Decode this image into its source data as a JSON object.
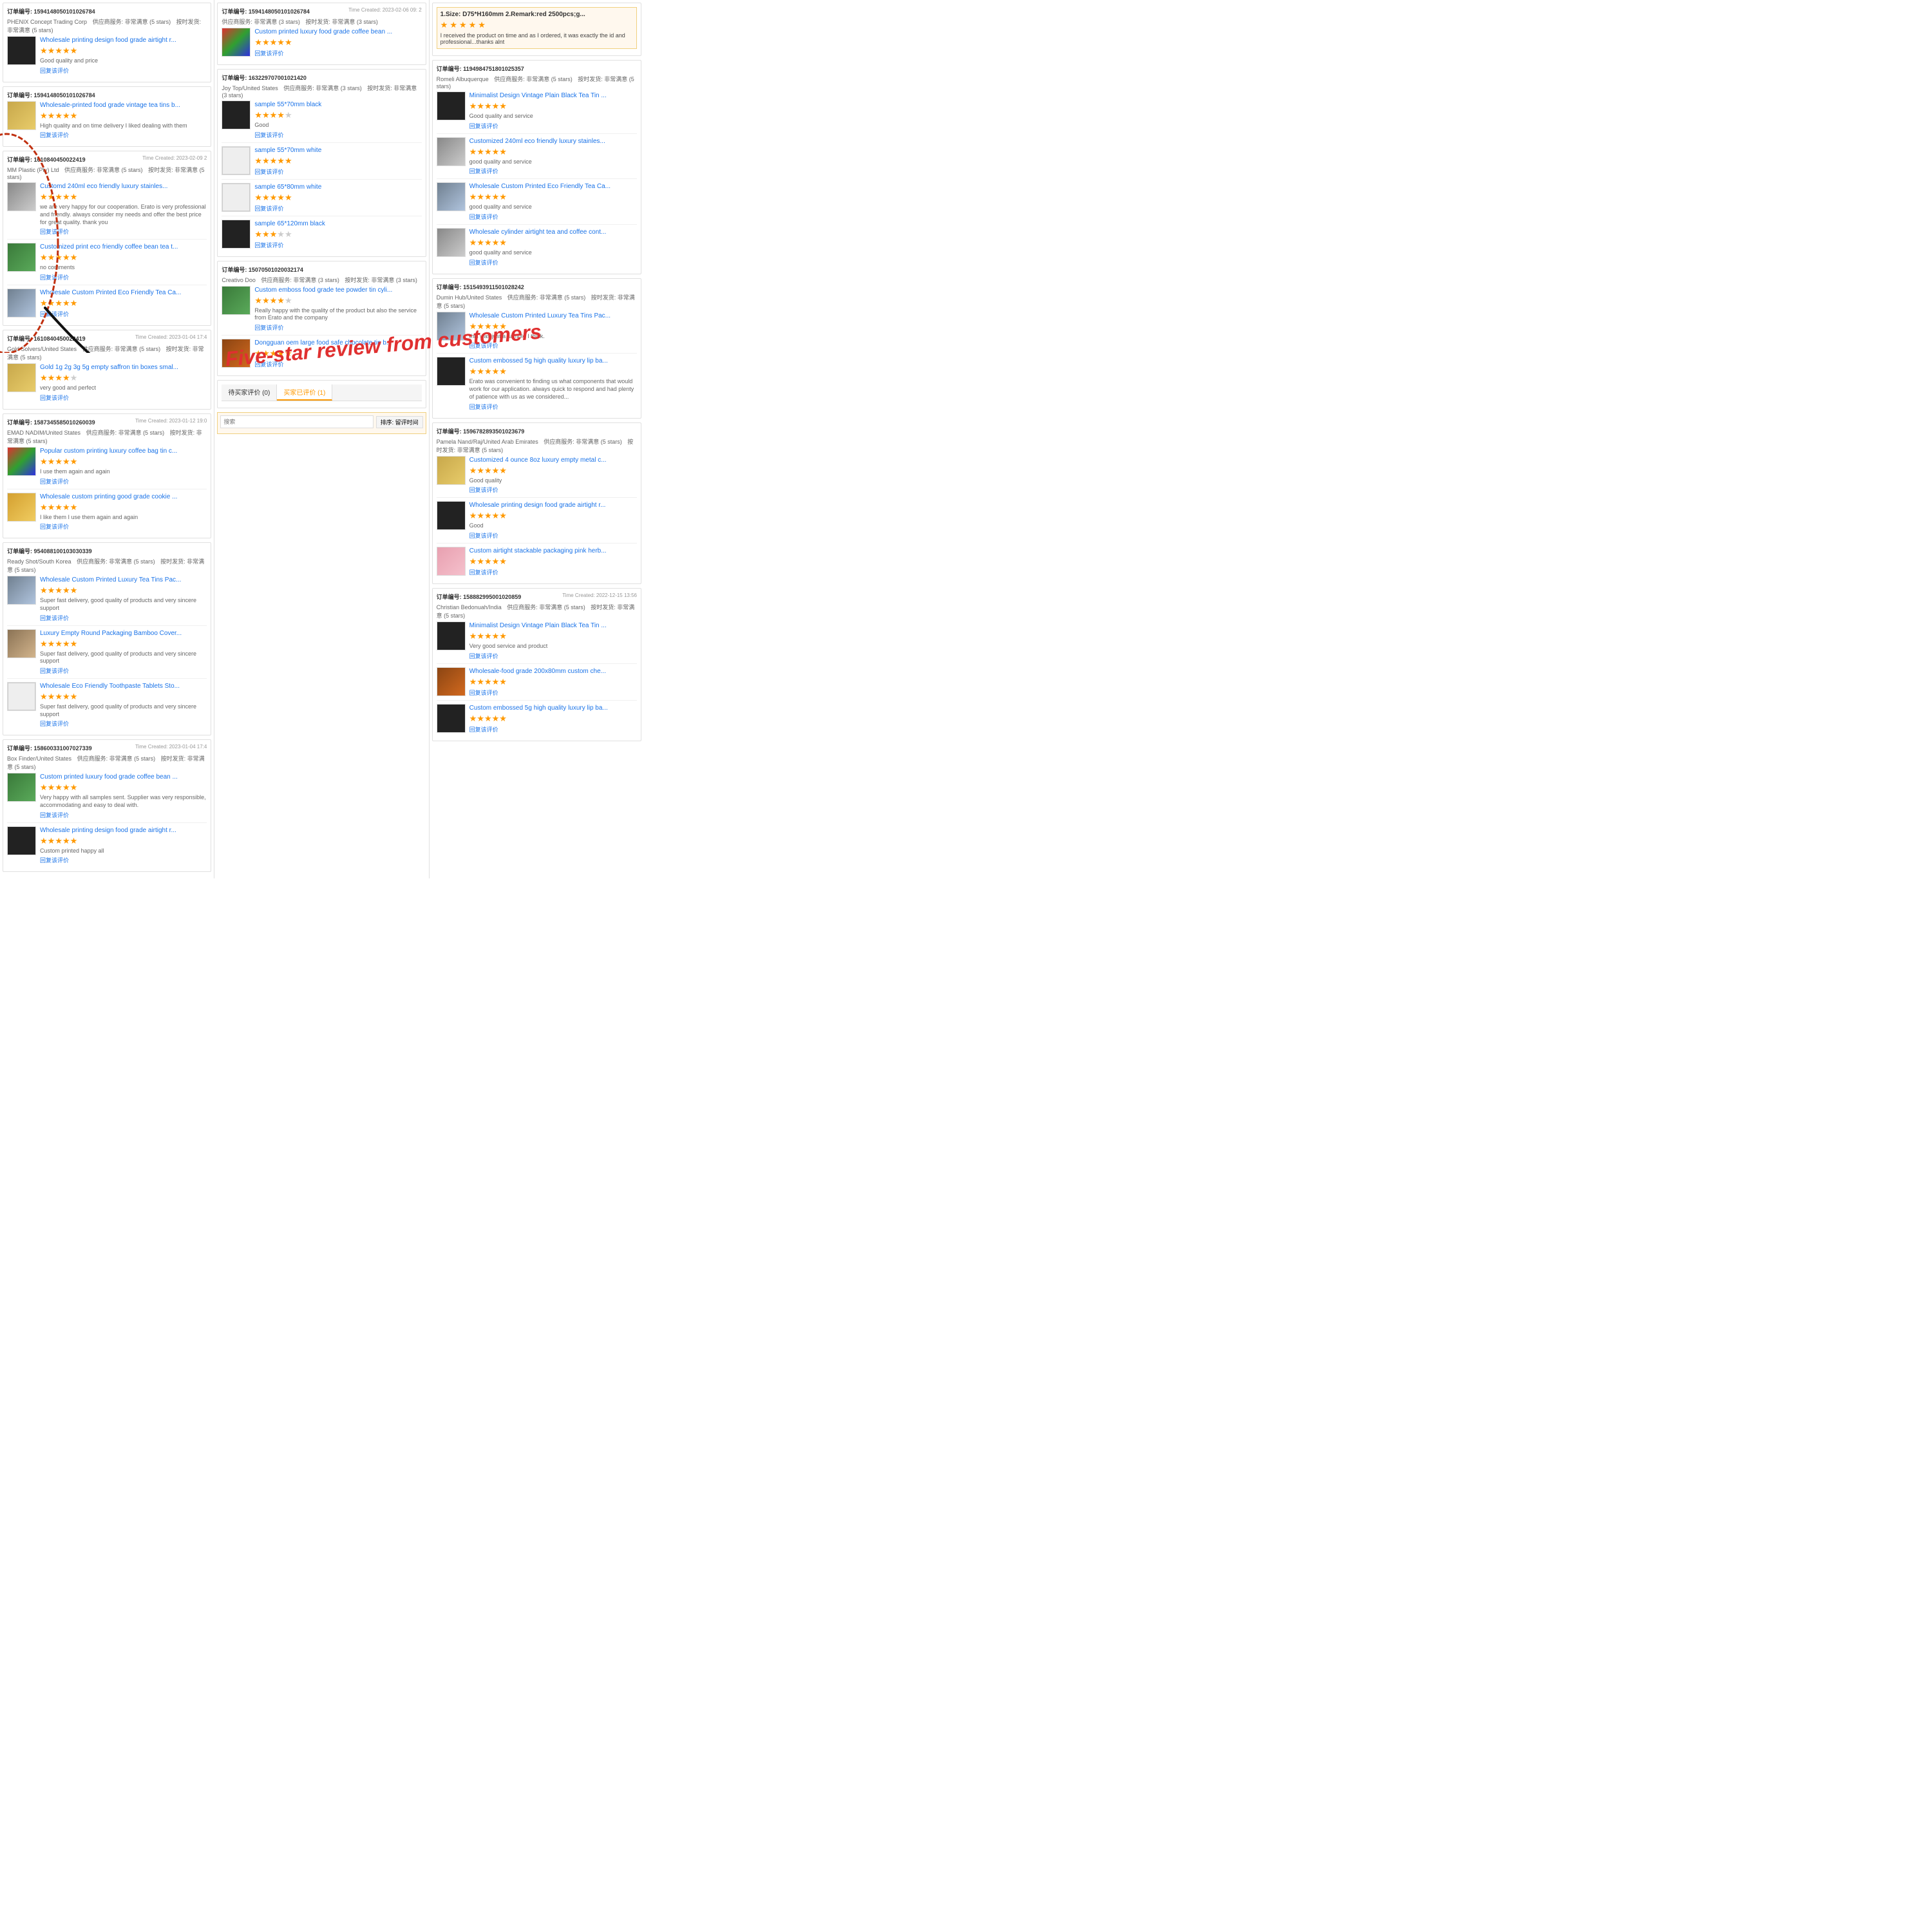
{
  "header": {
    "title": "Five-star review from customers"
  },
  "columns": [
    {
      "orders": [
        {
          "id": "订单编号: 1594148050101026784",
          "time": "",
          "company": "PHENIX Concept Trading Corp",
          "supplier_service": "供应商服务: 非常满意 (5 stars)",
          "logistics": "按时发货: 非常满意 (5 stars)",
          "reviews": [
            {
              "title": "Wholesale printing design food grade airtight r...",
              "stars": 5,
              "text": "Good quality and price",
              "thumb_type": "thumb-black",
              "reply_label": "回复该评价"
            }
          ]
        },
        {
          "id": "订单编号: 1594148050101026784",
          "time": "",
          "company": "",
          "supplier_service": "",
          "logistics": "",
          "reviews": [
            {
              "title": "Wholesale-printed food grade vintage tea tins b...",
              "stars": 5,
              "text": "High quality and on time delivery I liked dealing with them",
              "thumb_type": "thumb-gold",
              "reply_label": "回复该评价"
            }
          ]
        },
        {
          "id": "订单编号: 1610840450022419",
          "time": "Time Created: 2023-02-09 2",
          "company": "MM Plastic (Pty) Ltd",
          "supplier_service": "供应商服务: 非常满意 (5 stars)",
          "logistics": "按时发货: 非常满意 (5 stars)",
          "reviews": [
            {
              "title": "Customd 240ml eco friendly luxury stainles...",
              "stars": 5,
              "text": "we are very happy for our cooperation. Erato is very professional and friendly. always consider my needs and offer the best price for great quality. thank you",
              "thumb_type": "thumb-silver",
              "reply_label": "回复该评价"
            },
            {
              "title": "Customized print eco friendly coffee bean tea t...",
              "stars": 5,
              "text": "no comments",
              "thumb_type": "thumb-green",
              "reply_label": "回复该评价"
            },
            {
              "title": "Wholesale Custom Printed Eco Friendly Tea Ca...",
              "stars": 5,
              "text": "",
              "thumb_type": "thumb-tin",
              "reply_label": "回复该评价"
            }
          ]
        },
        {
          "id": "订单编号: 1610840450022419",
          "time": "Time Created: 2023-01-04 17:4",
          "company": "Gold Solvers/United States",
          "supplier_service": "供应商服务: 非常满意 (5 stars)",
          "logistics": "按时发货: 非常满意 (5 stars)",
          "reviews": [
            {
              "title": "Gold 1g 2g 3g 5g empty saffron tin boxes smal...",
              "stars": 4,
              "text": "very good and perfect",
              "thumb_type": "thumb-gold",
              "reply_label": "回复该评价"
            }
          ]
        },
        {
          "id": "订单编号: 1587345585010260039",
          "time": "Time Created: 2023-01-12 19:0",
          "company": "EMAD NADIM/United States",
          "supplier_service": "供应商服务: 非常满意 (5 stars)",
          "logistics": "按时发货: 非常满意 (5 stars)",
          "reviews": [
            {
              "title": "Popular custom printing luxury coffee bag tin c...",
              "stars": 5,
              "text": "I use them again and again",
              "thumb_type": "thumb-colorful",
              "reply_label": "回复该评价"
            },
            {
              "title": "Wholesale custom printing good grade cookie ...",
              "stars": 5,
              "text": "I like them I use them again and again",
              "thumb_type": "thumb-cookie",
              "reply_label": "回复该评价"
            }
          ]
        },
        {
          "id": "订单编号: 954088100103030339",
          "time": "",
          "company": "Ready Shot/South Korea",
          "supplier_service": "供应商服务: 非常满意 (5 stars)",
          "logistics": "按时发货: 非常满意 (5 stars)",
          "reviews": [
            {
              "title": "Wholesale Custom Printed Luxury Tea Tins Pac...",
              "stars": 5,
              "text": "Super fast delivery, good quality of products and very sincere support",
              "thumb_type": "thumb-tin",
              "reply_label": "回复该评价"
            },
            {
              "title": "Luxury Empty Round Packaging Bamboo Cover...",
              "stars": 5,
              "text": "Super fast delivery, good quality of products and very sincere support",
              "thumb_type": "thumb-bamboo",
              "reply_label": "回复该评价"
            },
            {
              "title": "Wholesale Eco Friendly Toothpaste Tablets Sto...",
              "stars": 5,
              "text": "Super fast delivery, good quality of products and very sincere support",
              "thumb_type": "thumb-white",
              "reply_label": "回复该评价"
            }
          ]
        },
        {
          "id": "订单编号: 158600331007027339",
          "time": "Time Created: 2023-01-04 17:4",
          "company": "Box Finder/United States",
          "supplier_service": "供应商服务: 非常满意 (5 stars)",
          "logistics": "按时发货: 非常满意 (5 stars)",
          "reviews": [
            {
              "title": "Custom printed luxury food grade coffee bean ...",
              "stars": 5,
              "text": "Very happy with all samples sent. Supplier was very responsible, accommodating and easy to deal with.",
              "thumb_type": "thumb-green",
              "reply_label": "回复该评价"
            },
            {
              "title": "Wholesale printing design food grade airtight r...",
              "stars": 5,
              "text": "Custom printed happy all",
              "thumb_type": "thumb-black",
              "reply_label": "回复该评价"
            }
          ]
        }
      ]
    },
    {
      "orders": [
        {
          "id": "订单编号: 1594148050101026784",
          "time": "Time Created: 2023-02-06 09: 2",
          "company": "",
          "supplier_service": "供应商服务: 非常满意 (3 stars)",
          "logistics": "按时发货: 非常满意 (3 stars)",
          "reviews": [
            {
              "title": "Custom printed luxury food grade coffee bean ...",
              "stars": 5,
              "text": "",
              "thumb_type": "thumb-colorful",
              "reply_label": "回复该评价"
            }
          ]
        },
        {
          "id": "订单编号: 163229707001021420",
          "time": "",
          "company": "Joy Top/United States",
          "supplier_service": "供应商服务: 非常满意 (3 stars)",
          "logistics": "按时发货: 非常满意 (3 stars)",
          "reviews": [
            {
              "title": "sample 55*70mm black",
              "stars": 4,
              "text": "Good",
              "thumb_type": "thumb-black",
              "reply_label": "回复该评价"
            },
            {
              "title": "sample 55*70mm white",
              "stars": 5,
              "text": "",
              "thumb_type": "thumb-white",
              "reply_label": "回复该评价"
            },
            {
              "title": "sample 65*80mm white",
              "stars": 5,
              "text": "",
              "thumb_type": "thumb-white",
              "reply_label": "回复该评价"
            },
            {
              "title": "sample 65*120mm black",
              "stars": 3,
              "text": "",
              "thumb_type": "thumb-black",
              "reply_label": "回复该评价"
            }
          ]
        },
        {
          "id": "订单编号: 15070501020032174",
          "time": "",
          "company": "Creativo Doo",
          "supplier_service": "供应商服务: 非常满意 (3 stars)",
          "logistics": "按时发货: 非常满意 (3 stars)",
          "reviews": [
            {
              "title": "Custom emboss food grade tee powder tin cyli...",
              "stars": 4,
              "text": "Really happy with the quality of the product but also the service from Erato and the company",
              "thumb_type": "thumb-green",
              "reply_label": "回复该评价"
            },
            {
              "title": "Dongguan oem large food safe chocolate tin b...",
              "stars": 5,
              "text": "",
              "thumb_type": "thumb-mixed",
              "reply_label": "回复该评价"
            }
          ]
        },
        {
          "id": "",
          "time": "",
          "company": "",
          "supplier_service": "",
          "logistics": "",
          "tab_section": true,
          "tabs": [
            "待买家评价 (0)",
            "买家已评价 (1)"
          ],
          "active_tab": "买家已评价 (1)",
          "reviews": []
        }
      ]
    },
    {
      "orders": [
        {
          "id": "",
          "time": "",
          "company": "",
          "supplier_service": "",
          "logistics": "",
          "top_review": true,
          "top_text": "1.Size: D75*H160mm 2.Remark:red 2500pcs;g...",
          "top_detail": "I received the product on time and as I ordered, it was exactly the id and professional...thanks alnt",
          "reviews": []
        },
        {
          "id": "订单编号: 1194984751801025357",
          "time": "",
          "company": "Romeli Albuquerque",
          "supplier_service": "供应商服务: 非常满意 (5 stars)",
          "logistics": "按时发货: 非常满意 (5 stars)",
          "reviews": [
            {
              "title": "Minimalist Design Vintage Plain Black Tea Tin ...",
              "stars": 5,
              "text": "Good quality and service",
              "thumb_type": "thumb-black",
              "reply_label": "回复该评价"
            },
            {
              "title": "Customized 240ml eco friendly luxury stainles...",
              "stars": 5,
              "text": "good quality and service",
              "thumb_type": "thumb-silver",
              "reply_label": "回复该评价"
            },
            {
              "title": "Wholesale Custom Printed Eco Friendly Tea Ca...",
              "stars": 5,
              "text": "good quality and service",
              "thumb_type": "thumb-tin",
              "reply_label": "回复该评价"
            },
            {
              "title": "Wholesale cylinder airtight tea and coffee cont...",
              "stars": 5,
              "text": "good quality and service",
              "thumb_type": "thumb-silver",
              "reply_label": "回复该评价"
            }
          ]
        },
        {
          "id": "订单编号: 1515493911501028242",
          "time": "",
          "company": "Dumin Hub/United States",
          "supplier_service": "供应商服务: 非常满意 (5 stars)",
          "logistics": "按时发货: 非常满意 (5 stars)",
          "reviews": [
            {
              "title": "Wholesale Custom Printed Luxury Tea Tins Pac...",
              "stars": 5,
              "text": "this was just a sample I think.",
              "thumb_type": "thumb-tin",
              "reply_label": "回复该评价"
            },
            {
              "title": "Custom embossed 5g high quality luxury lip ba...",
              "stars": 5,
              "text": "Erato was convenient to finding us what components that would work for our application. always quick to respond and had plenty of patience with us as we considered...",
              "thumb_type": "thumb-black",
              "reply_label": "回复该评价"
            }
          ]
        },
        {
          "id": "订单编号: 1596782893501023679",
          "time": "",
          "company": "Pamela Nand/Raj/United Arab Emirates",
          "supplier_service": "供应商服务: 非常满意 (5 stars)",
          "logistics": "按时发货: 非常满意 (5 stars)",
          "reviews": [
            {
              "title": "Customized 4 ounce 8oz luxury empty metal c...",
              "stars": 5,
              "text": "Good quality",
              "thumb_type": "thumb-gold",
              "reply_label": "回复该评价"
            },
            {
              "title": "Wholesale printing design food grade airtight r...",
              "stars": 5,
              "text": "Good",
              "thumb_type": "thumb-black",
              "reply_label": "回复该评价"
            },
            {
              "title": "Custom airtight stackable packaging pink herb...",
              "stars": 5,
              "text": "",
              "thumb_type": "thumb-pink",
              "reply_label": "回复该评价"
            }
          ]
        },
        {
          "id": "订单编号: 158882995001020859",
          "time": "Time Created: 2022-12-15 13:56",
          "company": "Christian Bedonuah/India",
          "supplier_service": "供应商服务: 非常满意 (5 stars)",
          "logistics": "按时发货: 非常满意 (5 stars)",
          "reviews": [
            {
              "title": "Minimalist Design Vintage Plain Black Tea Tin ...",
              "stars": 5,
              "text": "Very good service and product",
              "thumb_type": "thumb-black",
              "reply_label": "回复该评价"
            },
            {
              "title": "Wholesale-food grade 200x80mm custom che...",
              "stars": 5,
              "text": "",
              "thumb_type": "thumb-mixed",
              "reply_label": "回复该评价"
            },
            {
              "title": "Custom embossed 5g high quality luxury lip ba...",
              "stars": 5,
              "text": "",
              "thumb_type": "thumb-black",
              "reply_label": "回复该评价"
            }
          ]
        }
      ]
    }
  ],
  "search": {
    "placeholder": "搜索",
    "search_label": "搜索",
    "sort_label": "排序: 留评时间"
  },
  "tabs": {
    "pending": "待买家评价 (0)",
    "completed": "买家已评价 (1)"
  },
  "overlay": {
    "text": "Five-star review from  customers"
  }
}
